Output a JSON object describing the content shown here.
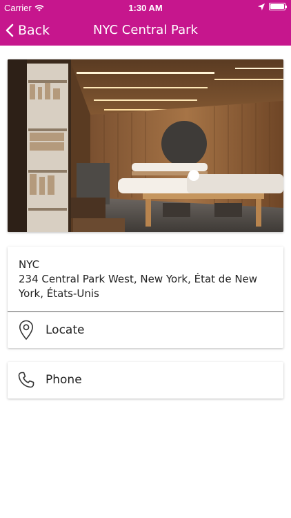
{
  "status_bar": {
    "carrier": "Carrier",
    "time": "1:30 AM"
  },
  "nav": {
    "back_label": "Back",
    "title": "NYC Central Park"
  },
  "location": {
    "name": "NYC",
    "address": "234 Central Park West, New York, État de New York, États-Unis"
  },
  "actions": {
    "locate_label": "Locate",
    "phone_label": "Phone"
  },
  "colors": {
    "brand": "#c6168d"
  }
}
